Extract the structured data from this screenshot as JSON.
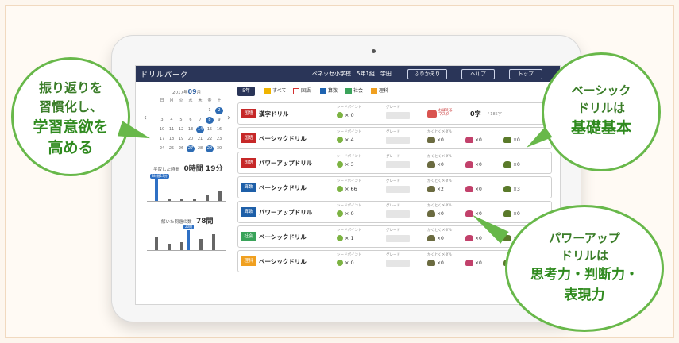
{
  "app": {
    "title": "ドリルパーク",
    "school": "ベネッセ小学校　5年1組　学田",
    "buttons": [
      "ふりかえり",
      "ヘルプ",
      "トップ"
    ]
  },
  "calendar": {
    "year": "2017年",
    "month": "09",
    "month_unit": "月",
    "weekdays": [
      "日",
      "月",
      "火",
      "水",
      "木",
      "金",
      "土"
    ],
    "days": [
      "",
      "",
      "",
      "",
      "",
      "1",
      "2",
      "3",
      "4",
      "5",
      "6",
      "7",
      "8",
      "9",
      "10",
      "11",
      "12",
      "13",
      "14",
      "15",
      "16",
      "17",
      "18",
      "19",
      "20",
      "21",
      "22",
      "23",
      "24",
      "25",
      "26",
      "27",
      "28",
      "29",
      "30"
    ],
    "highlighted": [
      "2",
      "8",
      "14",
      "27",
      "29"
    ]
  },
  "study_time": {
    "label": "学習した時間",
    "value": "0時間 19分"
  },
  "solved": {
    "label": "解いた問題の数",
    "value": "78問"
  },
  "grade_select": "5年",
  "subject_tabs": [
    "すべて",
    "国語",
    "算数",
    "社会",
    "理科"
  ],
  "tab_colors": [
    "#f0b400",
    "#d32f2f",
    "#1e63b0",
    "#3aa35a",
    "#f0a020"
  ],
  "rows": [
    {
      "subject": "国語",
      "color": "#c62828",
      "name": "漢字ドリル",
      "seed_label": "シードポイント",
      "seed": "× 0",
      "grade_label": "グレード",
      "extra": "おぼえる\nマスター",
      "kanji": "0字",
      "kanji_total": "/ 185字"
    },
    {
      "subject": "国語",
      "color": "#c62828",
      "name": "ベーシックドリル",
      "seed_label": "シードポイント",
      "seed": "× 4",
      "grade_label": "グレード",
      "medal_label": "かくとくメダル",
      "medals": [
        "×0",
        "×0",
        "×0"
      ]
    },
    {
      "subject": "国語",
      "color": "#c62828",
      "name": "パワーアップドリル",
      "seed_label": "シードポイント",
      "seed": "× 3",
      "grade_label": "グレード",
      "medal_label": "かくとくメダル",
      "medals": [
        "×0",
        "×0",
        "×0"
      ]
    },
    {
      "subject": "算数",
      "color": "#1e5fa8",
      "name": "ベーシックドリル",
      "seed_label": "シードポイント",
      "seed": "× 66",
      "grade_label": "グレード",
      "medal_label": "かくとくメダル",
      "medals": [
        "×2",
        "×0",
        "×3"
      ]
    },
    {
      "subject": "算数",
      "color": "#1e5fa8",
      "name": "パワーアップドリル",
      "seed_label": "シードポイント",
      "seed": "× 0",
      "grade_label": "グレード",
      "medal_label": "かくとくメダル",
      "medals": [
        "×0",
        "×0",
        "×0"
      ]
    },
    {
      "subject": "社会",
      "color": "#3aa35a",
      "name": "ベーシックドリル",
      "seed_label": "シードポイント",
      "seed": "× 1",
      "grade_label": "グレード",
      "medal_label": "かくとくメダル",
      "medals": [
        "×0",
        "×0",
        "×0"
      ]
    },
    {
      "subject": "理科",
      "color": "#f0a020",
      "name": "ベーシックドリル",
      "seed_label": "シードポイント",
      "seed": "× 0",
      "grade_label": "グレード",
      "medal_label": "かくとくメダル",
      "medals": [
        "×0",
        "×0",
        "×0"
      ]
    }
  ],
  "callouts": {
    "left": [
      "振り返りを",
      "習慣化し、",
      "学習意欲を",
      "高める"
    ],
    "right_top": [
      "ベーシック",
      "ドリルは",
      "基礎基本"
    ],
    "right_bottom": [
      "パワーアップ",
      "ドリルは",
      "思考力・判断力・",
      "表現力"
    ]
  }
}
